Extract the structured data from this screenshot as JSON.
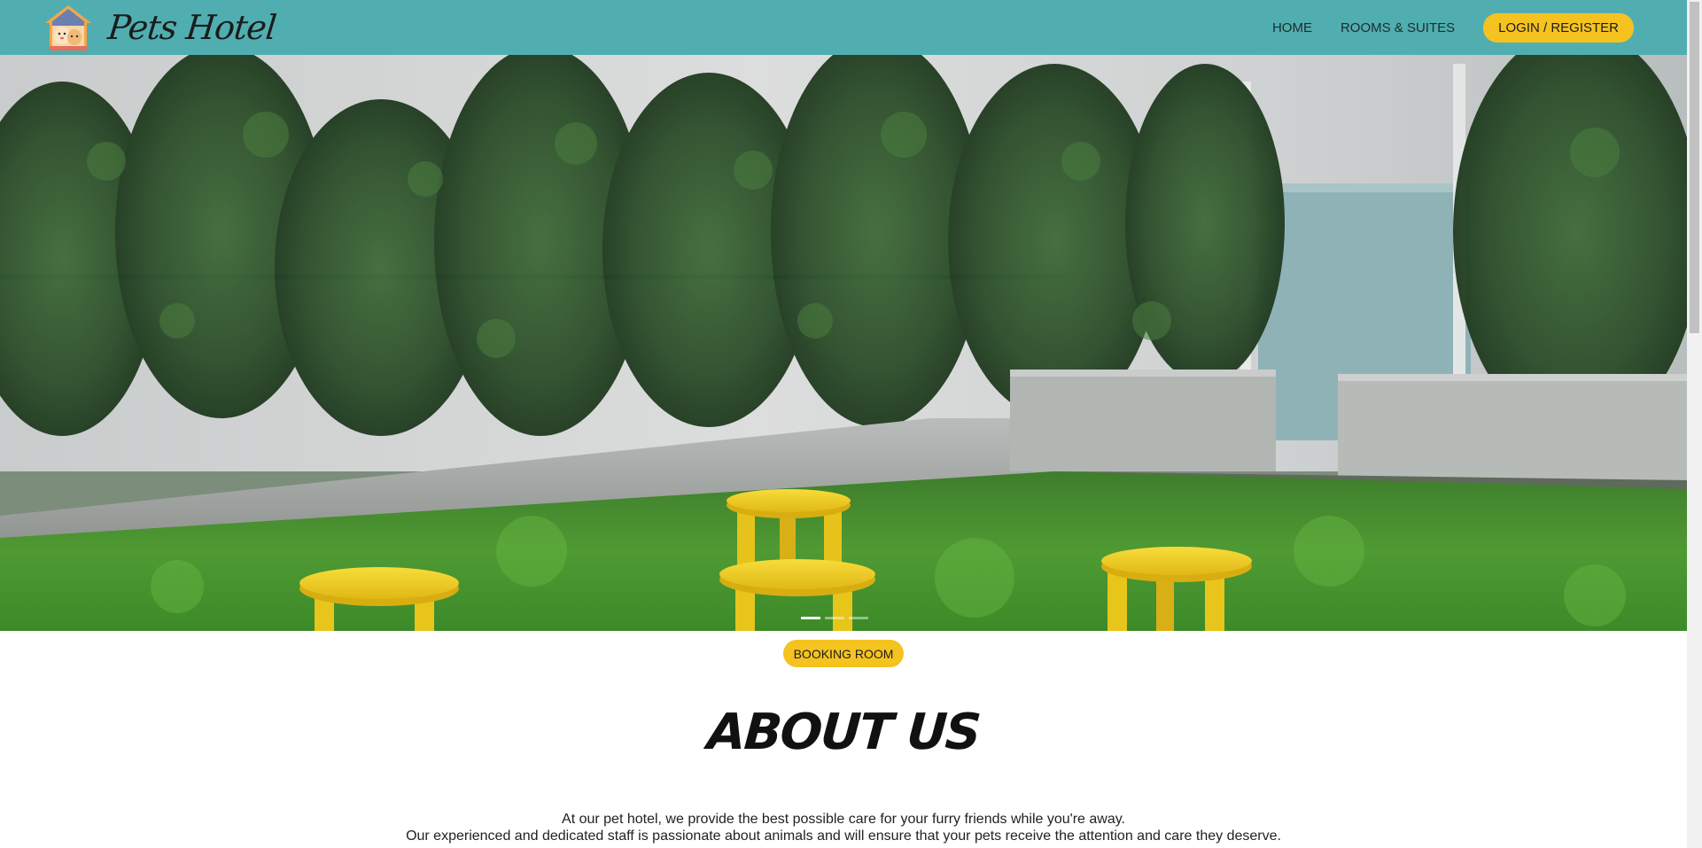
{
  "header": {
    "brand_name": "Pets Hotel",
    "brand_logo": "pet-house-icon",
    "nav": {
      "home": "HOME",
      "rooms": "ROOMS & SUITES",
      "login": "LOGIN / REGISTER"
    }
  },
  "hero": {
    "image": "garden-with-yellow-stools",
    "slides_count": 3,
    "active_slide": 1
  },
  "booking": {
    "label": "BOOKING ROOM"
  },
  "about": {
    "title": "ABOUT US",
    "line1": "At our pet hotel, we provide the best possible care for your furry friends while you're away.",
    "line2": "Our experienced and dedicated staff is passionate about animals and will ensure that your pets receive the attention and care they deserve."
  },
  "colors": {
    "navbar": "#50aeb0",
    "accent": "#f5c31f"
  }
}
